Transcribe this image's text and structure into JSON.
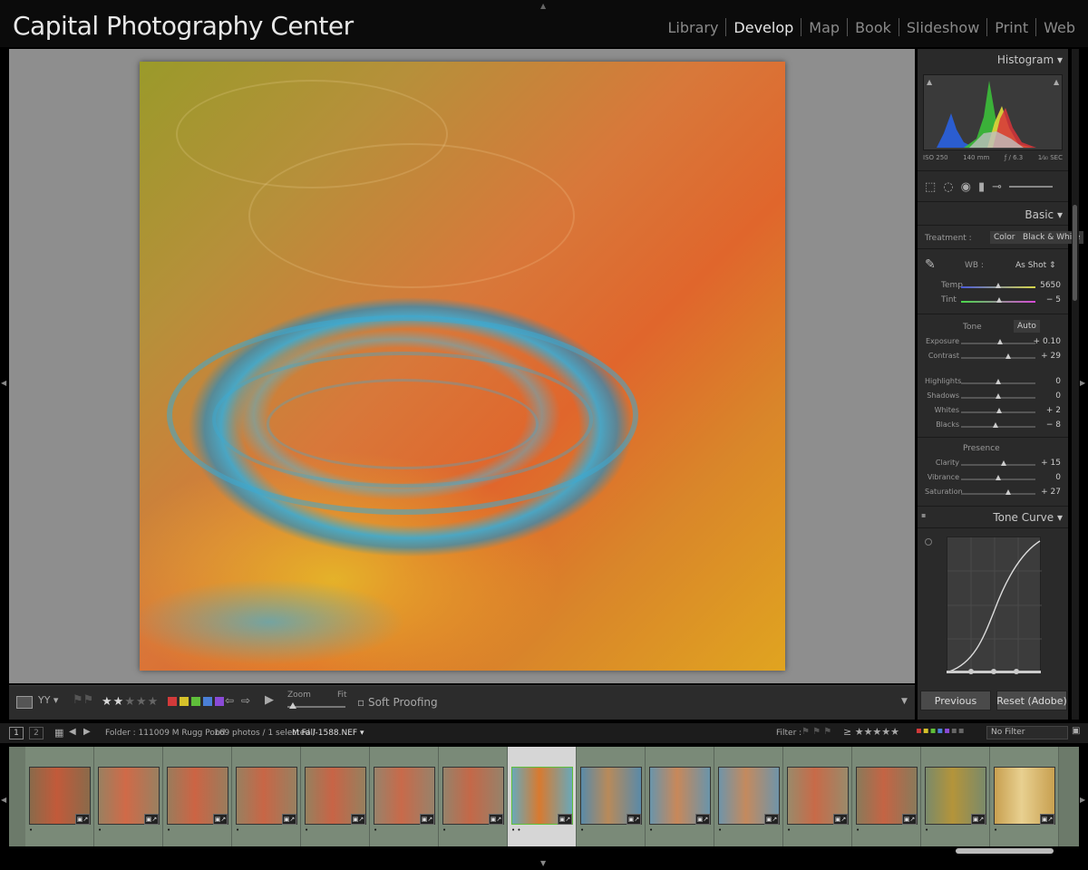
{
  "app": {
    "identity_plate": "Capital Photography Center"
  },
  "modules": [
    "Library",
    "Develop",
    "Map",
    "Book",
    "Slideshow",
    "Print",
    "Web"
  ],
  "active_module": "Develop",
  "toolbar": {
    "rating": 2,
    "rating_max": 5,
    "color_labels": [
      "#d23a3a",
      "#d6c22a",
      "#5fbf3a",
      "#4a7fd6",
      "#8a4ad6"
    ],
    "zoom_label": "Zoom",
    "fit_label": "Fit",
    "soft_proofing": "Soft Proofing"
  },
  "right_panel": {
    "histogram": {
      "title": "Histogram",
      "iso": "ISO 250",
      "focal": "140 mm",
      "aperture": "ƒ / 6.3",
      "shutter": "1⁄₄₀ SEC"
    },
    "basic": {
      "title": "Basic",
      "treatment_label": "Treatment :",
      "color": "Color",
      "bw": "Black & White",
      "wb_label": "WB :",
      "wb_value": "As Shot",
      "temp_label": "Temp",
      "temp_value": "5650",
      "tint_label": "Tint",
      "tint_value": "− 5",
      "tone_label": "Tone",
      "auto": "Auto",
      "sliders": [
        {
          "label": "Exposure",
          "value": "+ 0.10",
          "pos": 0.52
        },
        {
          "label": "Contrast",
          "value": "+ 29",
          "pos": 0.64
        },
        {
          "label": "Highlights",
          "value": "0",
          "pos": 0.5
        },
        {
          "label": "Shadows",
          "value": "0",
          "pos": 0.5
        },
        {
          "label": "Whites",
          "value": "+ 2",
          "pos": 0.51
        },
        {
          "label": "Blacks",
          "value": "− 8",
          "pos": 0.46
        }
      ],
      "presence_label": "Presence",
      "presence_sliders": [
        {
          "label": "Clarity",
          "value": "+ 15",
          "pos": 0.57
        },
        {
          "label": "Vibrance",
          "value": "0",
          "pos": 0.5
        },
        {
          "label": "Saturation",
          "value": "+ 27",
          "pos": 0.63
        }
      ]
    },
    "tone_curve": {
      "title": "Tone Curve"
    },
    "previous_button": "Previous",
    "reset_button": "Reset (Adobe)"
  },
  "filmstrip_bar": {
    "screen1": "1",
    "screen2": "2",
    "folder": "Folder : 111009 M Rugg Pond",
    "count": "169 photos / 1 selected /",
    "filename": "M Fall-1588.NEF",
    "filter_label": "Filter :",
    "no_filter": "No Filter"
  },
  "filmstrip": {
    "thumbs": [
      {
        "c1": "#8a6a4a",
        "c2": "#c25a3a"
      },
      {
        "c1": "#9a8060",
        "c2": "#d06a48"
      },
      {
        "c1": "#9a7c5c",
        "c2": "#cc6444"
      },
      {
        "c1": "#988060",
        "c2": "#c86646"
      },
      {
        "c1": "#96805e",
        "c2": "#c86446"
      },
      {
        "c1": "#98826a",
        "c2": "#c86a4a"
      },
      {
        "c1": "#96826a",
        "c2": "#c46848"
      },
      {
        "c1": "#6aa8b8",
        "c2": "#d87a30"
      },
      {
        "c1": "#5a8aa8",
        "c2": "#b88a5a"
      },
      {
        "c1": "#6a94aa",
        "c2": "#c8885a"
      },
      {
        "c1": "#7094a8",
        "c2": "#c48a5e"
      },
      {
        "c1": "#9a8a6a",
        "c2": "#c86a48"
      },
      {
        "c1": "#8a7a5a",
        "c2": "#c46444"
      },
      {
        "c1": "#7a8a6a",
        "c2": "#b4943a"
      },
      {
        "c1": "#c8a050",
        "c2": "#e8d090"
      }
    ],
    "selected_index": 7
  }
}
